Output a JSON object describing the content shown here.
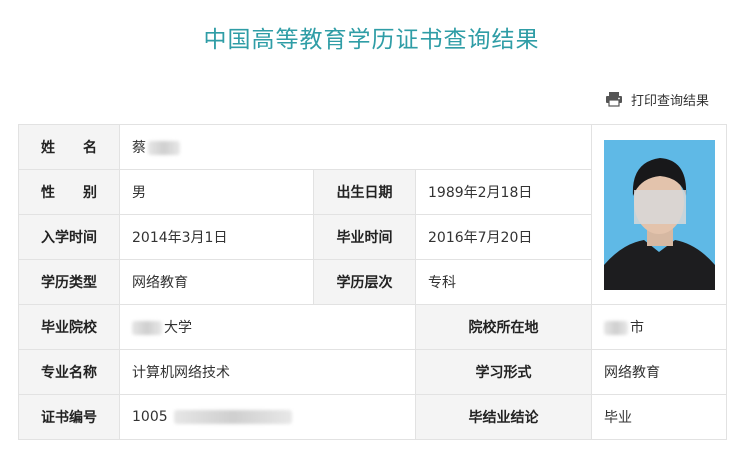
{
  "page": {
    "title": "中国高等教育学历证书查询结果",
    "print_label": "打印查询结果",
    "print_icon": "printer-icon"
  },
  "record": {
    "name": {
      "label": "姓　　名",
      "value": "蔡"
    },
    "gender": {
      "label": "性　　别",
      "value": "男"
    },
    "birth_date": {
      "label": "出生日期",
      "value": "1989年2月18日"
    },
    "enroll_date": {
      "label": "入学时间",
      "value": "2014年3月1日"
    },
    "grad_date": {
      "label": "毕业时间",
      "value": "2016年7月20日"
    },
    "edu_type": {
      "label": "学历类型",
      "value": "网络教育"
    },
    "edu_level": {
      "label": "学历层次",
      "value": "专科"
    },
    "school": {
      "label": "毕业院校",
      "value": "大学"
    },
    "school_location": {
      "label": "院校所在地",
      "value": "市"
    },
    "major": {
      "label": "专业名称",
      "value": "计算机网络技术"
    },
    "study_form": {
      "label": "学习形式",
      "value": "网络教育"
    },
    "cert_no": {
      "label": "证书编号",
      "value": "1005"
    },
    "conclusion": {
      "label": "毕结业结论",
      "value": "毕业"
    }
  },
  "colors": {
    "title": "#2f9da6",
    "label_bg": "#f4f4f4",
    "border": "#e2e2e2",
    "photo_bg": "#5fb9e6"
  }
}
